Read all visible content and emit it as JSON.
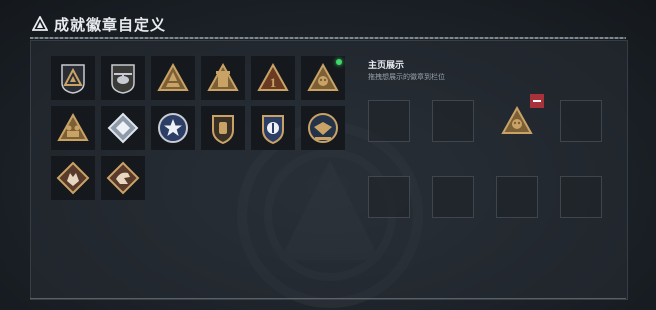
{
  "header": {
    "title": "成就徽章自定义",
    "icon": "warning-triangle-icon"
  },
  "badges": [
    {
      "icon": "triangle-emblem-badge-icon",
      "new": false
    },
    {
      "icon": "helicopter-badge-icon",
      "new": false
    },
    {
      "icon": "pyramid-badge-icon",
      "new": false
    },
    {
      "icon": "tower-badge-icon",
      "new": false
    },
    {
      "icon": "number-one-badge-icon",
      "new": false
    },
    {
      "icon": "skull-triangle-badge-icon",
      "new": true
    },
    {
      "icon": "soldiers-badge-icon",
      "new": false
    },
    {
      "icon": "crystal-badge-icon",
      "new": false
    },
    {
      "icon": "star-shield-badge-icon",
      "new": false
    },
    {
      "icon": "crest-badge-icon",
      "new": false
    },
    {
      "icon": "police-badge-icon",
      "new": false
    },
    {
      "icon": "eagle-shield-badge-icon",
      "new": false
    },
    {
      "icon": "wolf-diamond-badge-icon",
      "new": false
    },
    {
      "icon": "dragon-diamond-badge-icon",
      "new": false
    }
  ],
  "display": {
    "title": "主页展示",
    "subtitle": "拖拽想展示的徽章到栏位",
    "slots": [
      {
        "badge": null
      },
      {
        "badge": null
      },
      {
        "badge": "skull-triangle-badge-icon"
      },
      {
        "badge": null
      },
      {
        "badge": null
      },
      {
        "badge": null
      },
      {
        "badge": null
      },
      {
        "badge": null
      }
    ]
  },
  "colors": {
    "gold": "#c9a266",
    "dark_gold": "#7d5f36",
    "silver": "#c8ccd2",
    "new_dot": "#3fd86a",
    "remove": "#a9313a"
  }
}
